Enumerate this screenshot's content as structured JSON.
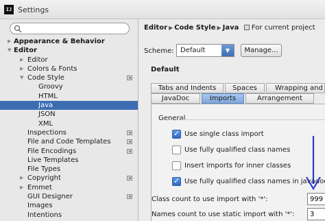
{
  "window": {
    "title": "Settings",
    "logo_text": "IJ"
  },
  "search": {
    "value": "",
    "icon": "search-icon"
  },
  "tree": [
    {
      "label": "Appearance & Behavior",
      "bold": true,
      "arrow": "▶",
      "level": 0,
      "project": false,
      "selected": false
    },
    {
      "label": "Editor",
      "bold": true,
      "arrow": "▼",
      "level": 0,
      "project": false,
      "selected": false
    },
    {
      "label": "Editor",
      "bold": false,
      "arrow": "▶",
      "level": 1,
      "project": false,
      "selected": false
    },
    {
      "label": "Colors & Fonts",
      "bold": false,
      "arrow": "▶",
      "level": 1,
      "project": false,
      "selected": false
    },
    {
      "label": "Code Style",
      "bold": false,
      "arrow": "▼",
      "level": 1,
      "project": true,
      "selected": false
    },
    {
      "label": "Groovy",
      "bold": false,
      "arrow": "",
      "level": 2,
      "project": false,
      "selected": false
    },
    {
      "label": "HTML",
      "bold": false,
      "arrow": "",
      "level": 2,
      "project": false,
      "selected": false
    },
    {
      "label": "Java",
      "bold": false,
      "arrow": "",
      "level": 2,
      "project": false,
      "selected": true
    },
    {
      "label": "JSON",
      "bold": false,
      "arrow": "",
      "level": 2,
      "project": false,
      "selected": false
    },
    {
      "label": "XML",
      "bold": false,
      "arrow": "",
      "level": 2,
      "project": false,
      "selected": false
    },
    {
      "label": "Inspections",
      "bold": false,
      "arrow": "",
      "level": 1,
      "project": true,
      "selected": false
    },
    {
      "label": "File and Code Templates",
      "bold": false,
      "arrow": "",
      "level": 1,
      "project": true,
      "selected": false
    },
    {
      "label": "File Encodings",
      "bold": false,
      "arrow": "",
      "level": 1,
      "project": true,
      "selected": false
    },
    {
      "label": "Live Templates",
      "bold": false,
      "arrow": "",
      "level": 1,
      "project": false,
      "selected": false
    },
    {
      "label": "File Types",
      "bold": false,
      "arrow": "",
      "level": 1,
      "project": false,
      "selected": false
    },
    {
      "label": "Copyright",
      "bold": false,
      "arrow": "▶",
      "level": 1,
      "project": true,
      "selected": false
    },
    {
      "label": "Emmet",
      "bold": false,
      "arrow": "▶",
      "level": 1,
      "project": false,
      "selected": false
    },
    {
      "label": "GUI Designer",
      "bold": false,
      "arrow": "",
      "level": 1,
      "project": true,
      "selected": false
    },
    {
      "label": "Images",
      "bold": false,
      "arrow": "",
      "level": 1,
      "project": false,
      "selected": false
    },
    {
      "label": "Intentions",
      "bold": false,
      "arrow": "",
      "level": 1,
      "project": false,
      "selected": false
    }
  ],
  "breadcrumb": {
    "part1": "Editor",
    "part2": "Code Style",
    "part3": "Java",
    "scope": "For current project"
  },
  "scheme": {
    "label": "Scheme:",
    "value": "Default",
    "manage_label": "Manage...",
    "name": "Default"
  },
  "tabs_row1": [
    "Tabs and Indents",
    "Spaces",
    "Wrapping and Braces"
  ],
  "tabs_row2": [
    "JavaDoc",
    "Imports",
    "Arrangement"
  ],
  "active_tab": "Imports",
  "general": {
    "title": "General",
    "options": [
      {
        "label": "Use single class import",
        "checked": true
      },
      {
        "label": "Use fully qualified class names",
        "checked": false
      },
      {
        "label": "Insert imports for inner classes",
        "checked": false
      },
      {
        "label": "Use fully qualified class names in javadoc",
        "checked": true
      }
    ],
    "class_count_label": "Class count to use import with '*':",
    "class_count_value": "999",
    "names_count_label": "Names count to use static import with '*':",
    "names_count_value": "3"
  },
  "colors": {
    "selection": "#3c6db3",
    "arrow": "#2a39c6"
  }
}
